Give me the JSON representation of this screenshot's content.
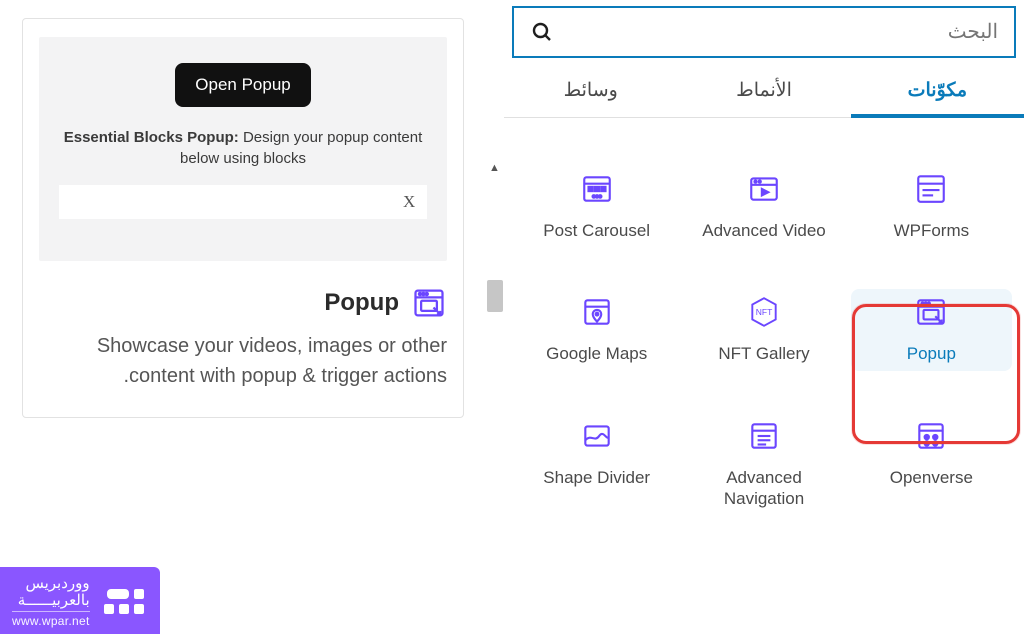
{
  "search": {
    "placeholder": "البحث"
  },
  "tabs": {
    "blocks": "مكوّنات",
    "patterns": "الأنماط",
    "media": "وسائط"
  },
  "blocks": {
    "post_carousel": "Post Carousel",
    "advanced_video": "Advanced Video",
    "wpforms": "WPForms",
    "google_maps": "Google Maps",
    "nft_gallery": "NFT Gallery",
    "popup": "Popup",
    "shape_divider": "Shape Divider",
    "advanced_nav": "Advanced Navigation",
    "openverse": "Openverse"
  },
  "preview": {
    "open_button": "Open Popup",
    "desc_bold": "Essential Blocks Popup:",
    "desc_rest": " Design your popup content below using blocks",
    "close_x": "X",
    "title": "Popup",
    "summary": "Showcase your videos, images or other content with popup & trigger actions."
  },
  "brand": {
    "line1": "ووردبريس",
    "line2": "بالعربيــــــة",
    "url": "www.wpar.net"
  }
}
